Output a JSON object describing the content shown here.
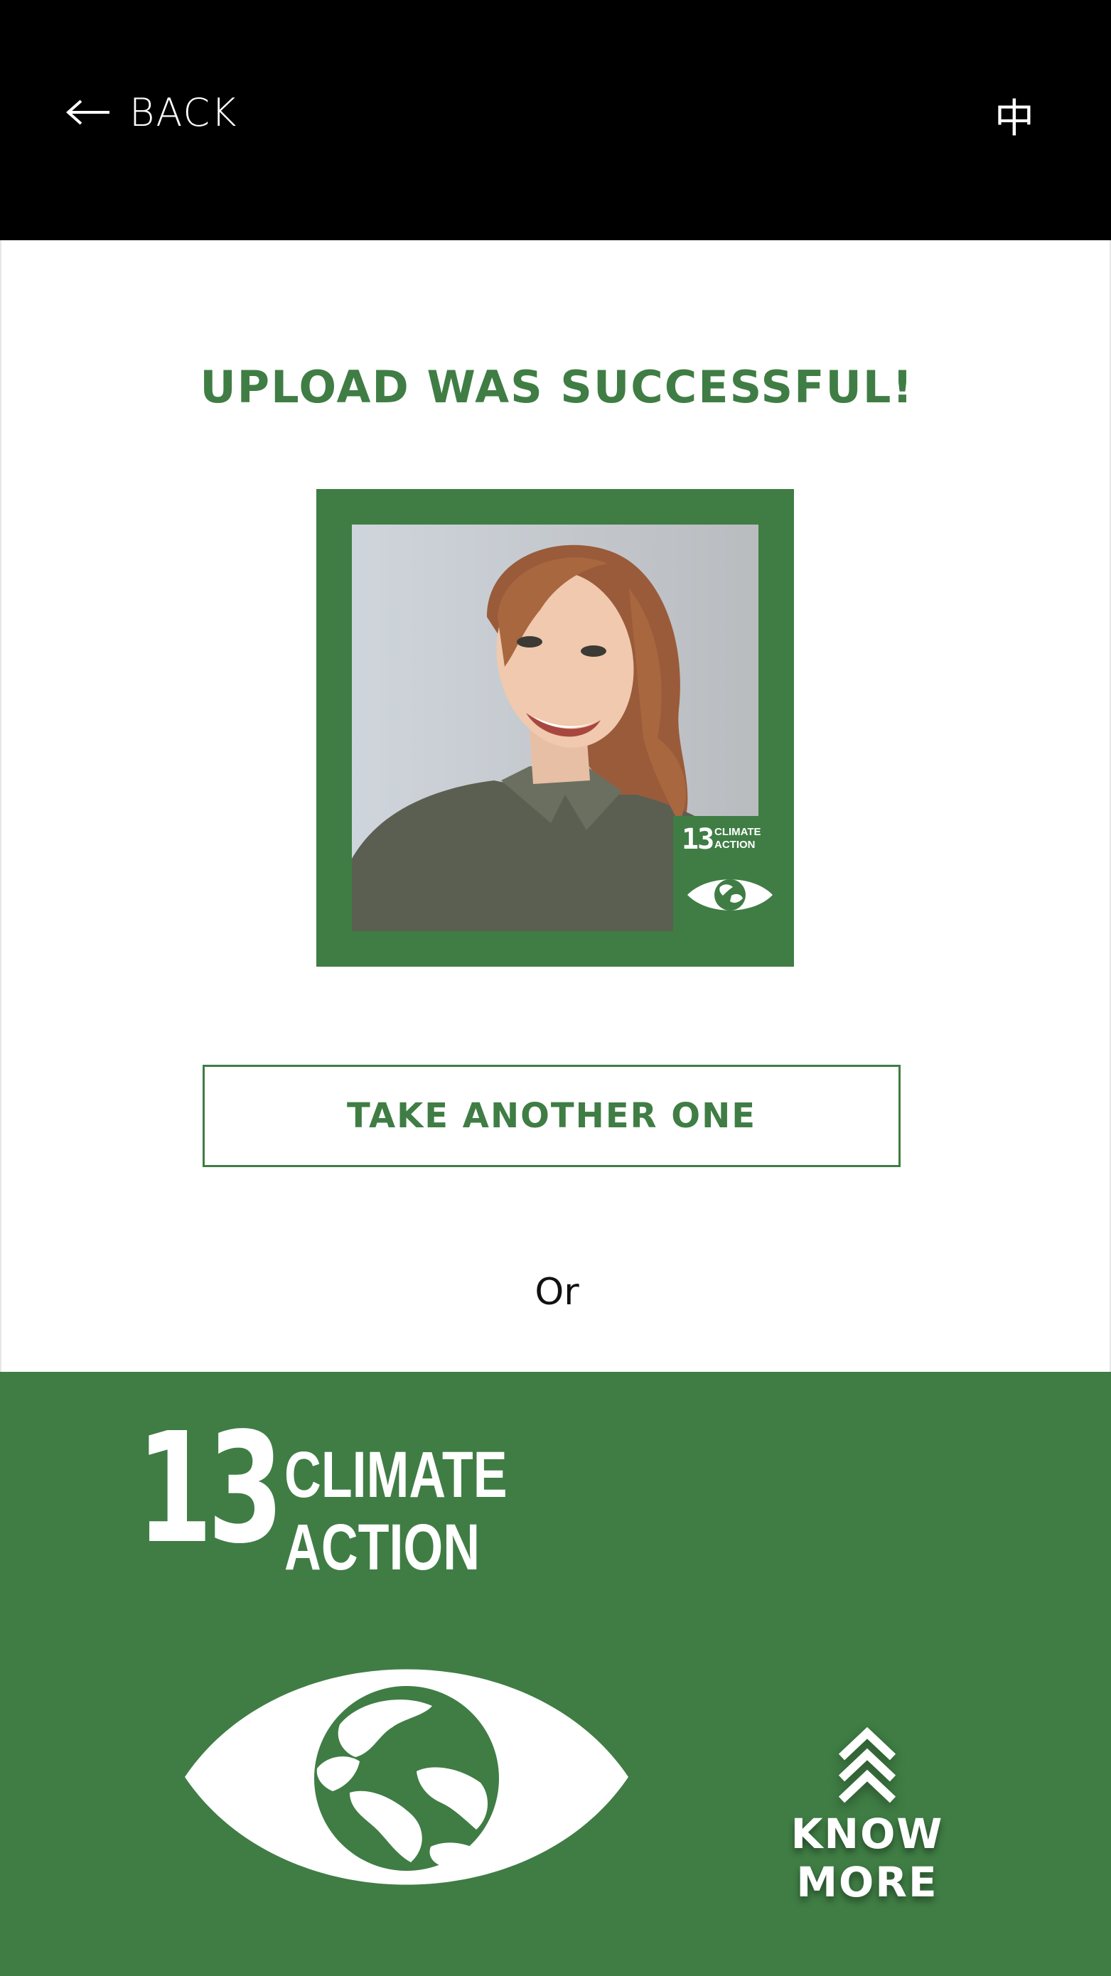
{
  "header": {
    "back_label": "BACK",
    "language_label": "中"
  },
  "main": {
    "title": "UPLOAD WAS SUCCESSFUL!",
    "photo_badge": {
      "number": "13",
      "line1": "CLIMATE",
      "line2": "ACTION"
    },
    "take_another_label": "TAKE ANOTHER ONE",
    "or_label": "Or"
  },
  "goal": {
    "number": "13",
    "line1": "CLIMATE",
    "line2": "ACTION",
    "know_more_label": "KNOW MORE"
  },
  "icons": {
    "back": "arrow-left-icon",
    "know_more": "double-chevron-up-icon",
    "goal": "eye-globe-icon"
  },
  "colors": {
    "header_bg": "#000000",
    "accent_green": "#3f7d44",
    "text_white": "#ffffff"
  }
}
